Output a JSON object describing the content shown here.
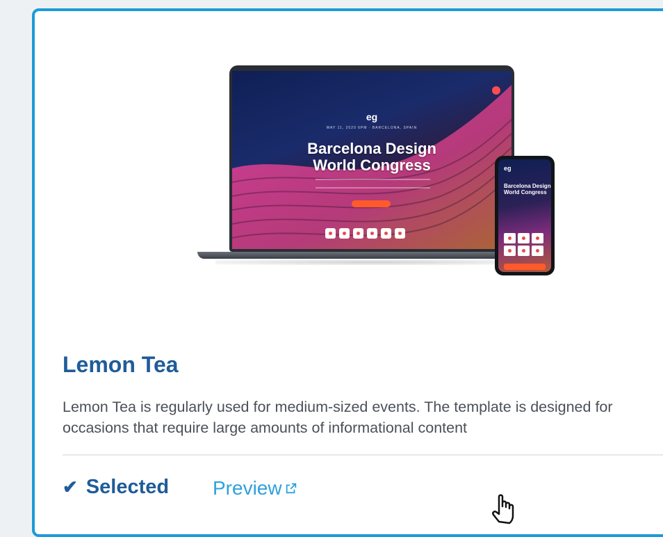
{
  "template": {
    "name": "Lemon Tea",
    "description": "Lemon Tea is regularly used for medium-sized events. The template is designed for occasions that require large amounts of informational content",
    "selected_label": "Selected",
    "preview_label": "Preview"
  },
  "mockup": {
    "logo": "eg",
    "meta": "MAY 11, 2020 6PM · BARCELONA, SPAIN",
    "title_line1": "Barcelona Design",
    "title_line2": "World Congress",
    "phone_logo": "eg",
    "phone_title": "Barcelona Design World Congress"
  },
  "colors": {
    "card_border": "#1d9bd8",
    "title": "#1f5c99",
    "link": "#2ea1dc"
  },
  "icons": [
    "check-icon",
    "external-link-icon",
    "hand-pointer-cursor-icon"
  ]
}
